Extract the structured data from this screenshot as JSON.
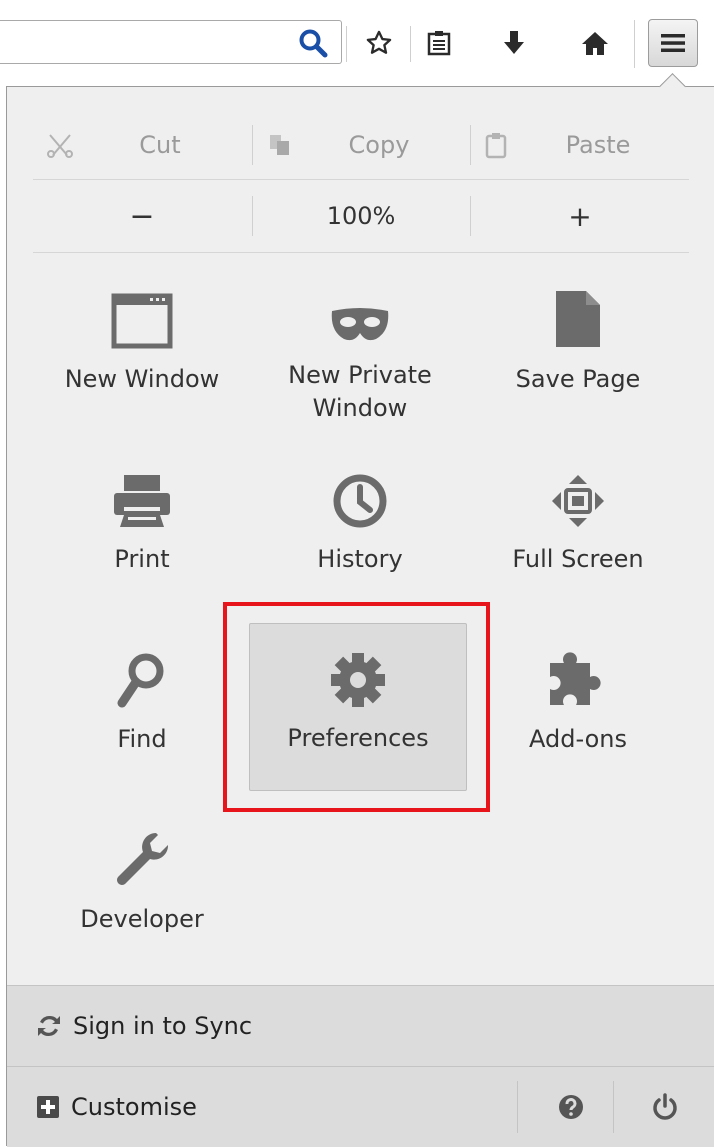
{
  "toolbar": {
    "icons": [
      "search-icon",
      "bookmark-star-icon",
      "reading-list-icon",
      "download-icon",
      "home-icon",
      "hamburger-menu-icon"
    ]
  },
  "menu": {
    "edit": {
      "cut": "Cut",
      "copy": "Copy",
      "paste": "Paste"
    },
    "zoom": {
      "out": "−",
      "level": "100%",
      "in": "+"
    },
    "tiles": [
      {
        "label": "New Window",
        "icon": "window-icon"
      },
      {
        "label": "New Private\nWindow",
        "icon": "private-mask-icon"
      },
      {
        "label": "Save Page",
        "icon": "page-icon"
      },
      {
        "label": "Print",
        "icon": "printer-icon"
      },
      {
        "label": "History",
        "icon": "clock-icon"
      },
      {
        "label": "Full Screen",
        "icon": "fullscreen-arrows-icon"
      },
      {
        "label": "Find",
        "icon": "magnifier-icon"
      },
      {
        "label": "Preferences",
        "icon": "gear-icon"
      },
      {
        "label": "Add-ons",
        "icon": "puzzle-icon"
      },
      {
        "label": "Developer",
        "icon": "wrench-icon"
      }
    ],
    "selected": "Preferences",
    "sync_label": "Sign in to Sync",
    "customise_label": "Customise"
  },
  "colors": {
    "highlight": "#e8141c",
    "panel_bg": "#efefef",
    "footer_bg": "#dcdcdc",
    "icon_gray": "#6b6b6b"
  }
}
